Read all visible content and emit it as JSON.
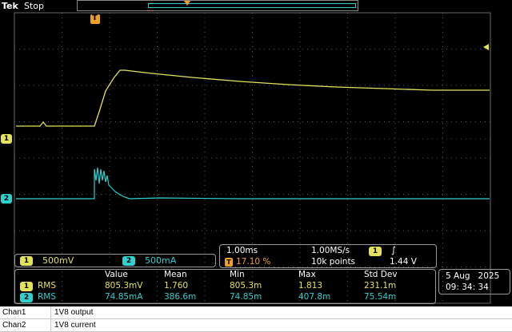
{
  "header": {
    "brand": "Tek",
    "state": "Stop"
  },
  "markers": {
    "trigger_glyph": "T",
    "ch1_marker": "1",
    "ch2_marker": "2"
  },
  "channel_scale": {
    "ch1_label": "1",
    "ch1_value": "500mV",
    "ch2_label": "2",
    "ch2_value": "500mA"
  },
  "timebase": {
    "horizontal_scale": "1.00ms",
    "sample_rate": "1.00MS/s",
    "trigger_position": "17.10 %",
    "record_length": "10k points",
    "trigger_source": "1",
    "trigger_slope_icon": "rising-edge",
    "trigger_level": "1.44 V"
  },
  "measurements": {
    "headers": [
      "Value",
      "Mean",
      "Min",
      "Max",
      "Std Dev"
    ],
    "rows": [
      {
        "channel": "1",
        "type": "RMS",
        "value": "805.3mV",
        "mean": "1.760",
        "min": "805.3m",
        "max": "1.813",
        "std": "231.1m"
      },
      {
        "channel": "2",
        "type": "RMS",
        "value": "74.85mA",
        "mean": "386.6m",
        "min": "74.85m",
        "max": "407.8m",
        "std": "75.54m"
      }
    ]
  },
  "datetime": {
    "date": "5 Aug   2025",
    "time": "09: 34: 34"
  },
  "legend": [
    {
      "key": "Chan1",
      "value": "1V8 output"
    },
    {
      "key": "Chan2",
      "value": "1V8 current"
    }
  ],
  "colors": {
    "ch1": "#e3e35a",
    "ch2": "#2fd0d0",
    "trigger": "#f0a020",
    "grid": "#6a6a6a"
  }
}
